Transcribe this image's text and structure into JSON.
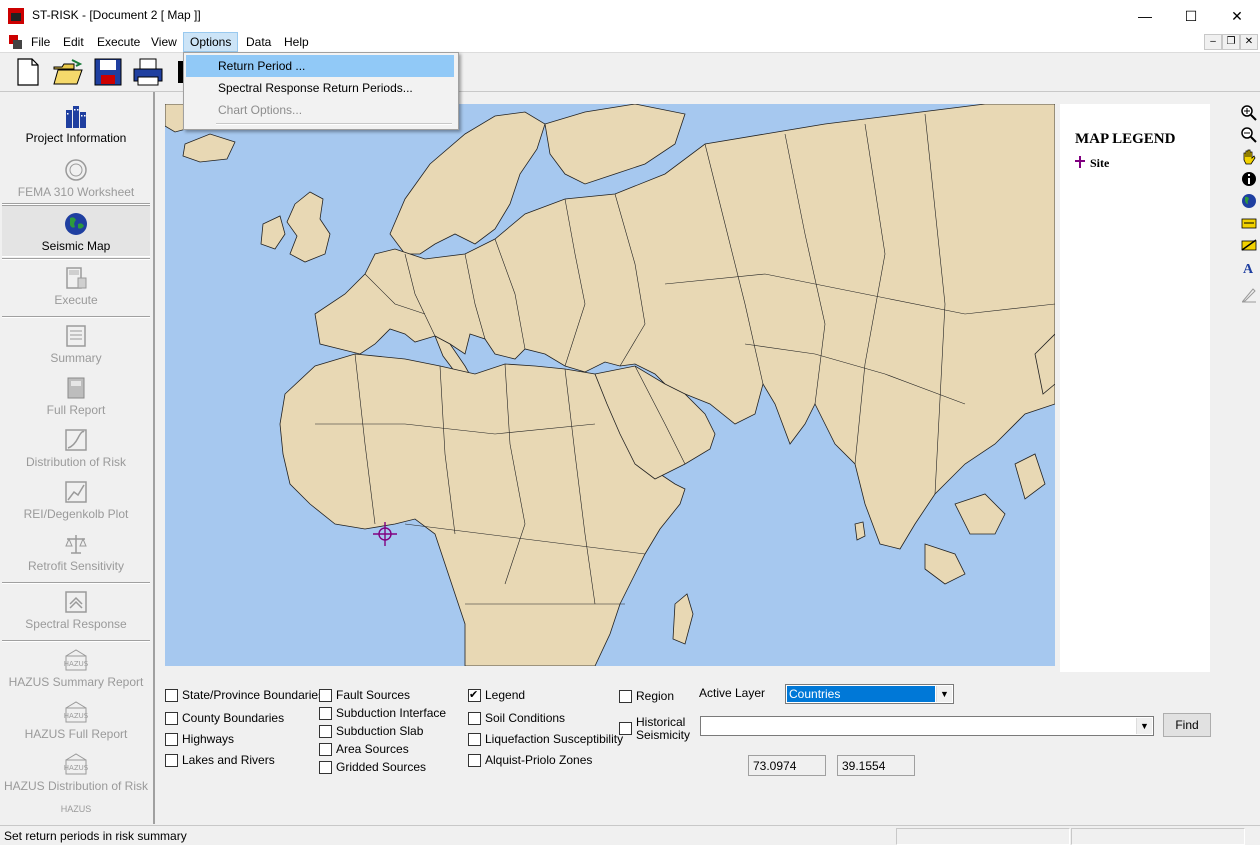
{
  "window": {
    "title": "ST-RISK - [Document 2 [ Map ]]",
    "minimize_glyph": "—",
    "maximize_glyph": "☐",
    "close_glyph": "✕"
  },
  "menubar": {
    "items": [
      "File",
      "Edit",
      "Execute",
      "View",
      "Options",
      "Data",
      "Help"
    ],
    "mdi_min": "–",
    "mdi_restore": "❐",
    "mdi_close": "✕"
  },
  "options_menu": {
    "items": [
      {
        "label": "Return Period ...",
        "state": "highlighted"
      },
      {
        "label": "Spectral Response Return Periods...",
        "state": "enabled"
      },
      {
        "label": "Chart Options...",
        "state": "disabled"
      }
    ]
  },
  "toolbar": {
    "icons": [
      "new-document-icon",
      "open-folder-icon",
      "save-disk-icon",
      "print-icon"
    ]
  },
  "left_nav": {
    "items": [
      {
        "label": "Project Information",
        "icon": "buildings-icon",
        "enabled": true
      },
      {
        "label": "FEMA 310 Worksheet",
        "icon": "fema-seal-icon",
        "enabled": false
      },
      {
        "label": "Seismic Map",
        "icon": "globe-icon",
        "enabled": true,
        "selected": true
      },
      {
        "label": "Execute",
        "icon": "calculator-icon",
        "enabled": false
      },
      {
        "label": "Summary",
        "icon": "summary-sheet-icon",
        "enabled": false
      },
      {
        "label": "Full Report",
        "icon": "report-book-icon",
        "enabled": false
      },
      {
        "label": "Distribution of Risk",
        "icon": "distribution-chart-icon",
        "enabled": false
      },
      {
        "label": "REI/Degenkolb Plot",
        "icon": "plot-chart-icon",
        "enabled": false
      },
      {
        "label": "Retrofit Sensitivity",
        "icon": "balance-scale-icon",
        "enabled": false
      },
      {
        "label": "Spectral Response",
        "icon": "spectral-icon",
        "enabled": false
      },
      {
        "label": "HAZUS Summary Report",
        "icon": "hazus-icon",
        "enabled": false
      },
      {
        "label": "HAZUS Full Report",
        "icon": "hazus-icon",
        "enabled": false
      },
      {
        "label": "HAZUS Distribution of Risk",
        "icon": "hazus-icon",
        "enabled": false
      },
      {
        "label": "HAZUS",
        "icon": "hazus-icon",
        "enabled": false
      }
    ]
  },
  "map": {
    "ocean_color": "#a6c8ef",
    "land_color": "#e8d8b4",
    "site_marker_color": "#800080"
  },
  "legend": {
    "title": "MAP LEGEND",
    "site_label": "Site"
  },
  "right_tools": [
    "zoom-in-icon",
    "zoom-out-icon",
    "pan-hand-icon",
    "info-icon",
    "globe-icon",
    "label-icon",
    "measure-icon",
    "text-icon",
    "ruler-icon"
  ],
  "layers": {
    "col1": [
      {
        "label": "State/Province Boundaries",
        "checked": false
      },
      {
        "label": "County Boundaries",
        "checked": false
      },
      {
        "label": "Highways",
        "checked": false
      },
      {
        "label": "Lakes and Rivers",
        "checked": false
      }
    ],
    "col2": [
      {
        "label": "Fault Sources",
        "checked": false
      },
      {
        "label": "Subduction Interface",
        "checked": false
      },
      {
        "label": "Subduction Slab",
        "checked": false
      },
      {
        "label": "Area Sources",
        "checked": false
      },
      {
        "label": "Gridded Sources",
        "checked": false
      }
    ],
    "col3": [
      {
        "label": "Legend",
        "checked": true
      },
      {
        "label": "Soil Conditions",
        "checked": false
      },
      {
        "label": "Liquefaction Susceptibility",
        "checked": false
      },
      {
        "label": "Alquist-Priolo Zones",
        "checked": false
      }
    ],
    "col4": [
      {
        "label": "Region",
        "checked": false
      },
      {
        "label": "Historical Seismicity",
        "checked": false
      }
    ]
  },
  "active_layer": {
    "label": "Active Layer",
    "value": "Countries"
  },
  "search": {
    "value": "",
    "find_label": "Find"
  },
  "coords": {
    "longitude": "73.0974",
    "latitude": "39.1554"
  },
  "status": {
    "text": "Set return periods in risk summary"
  }
}
